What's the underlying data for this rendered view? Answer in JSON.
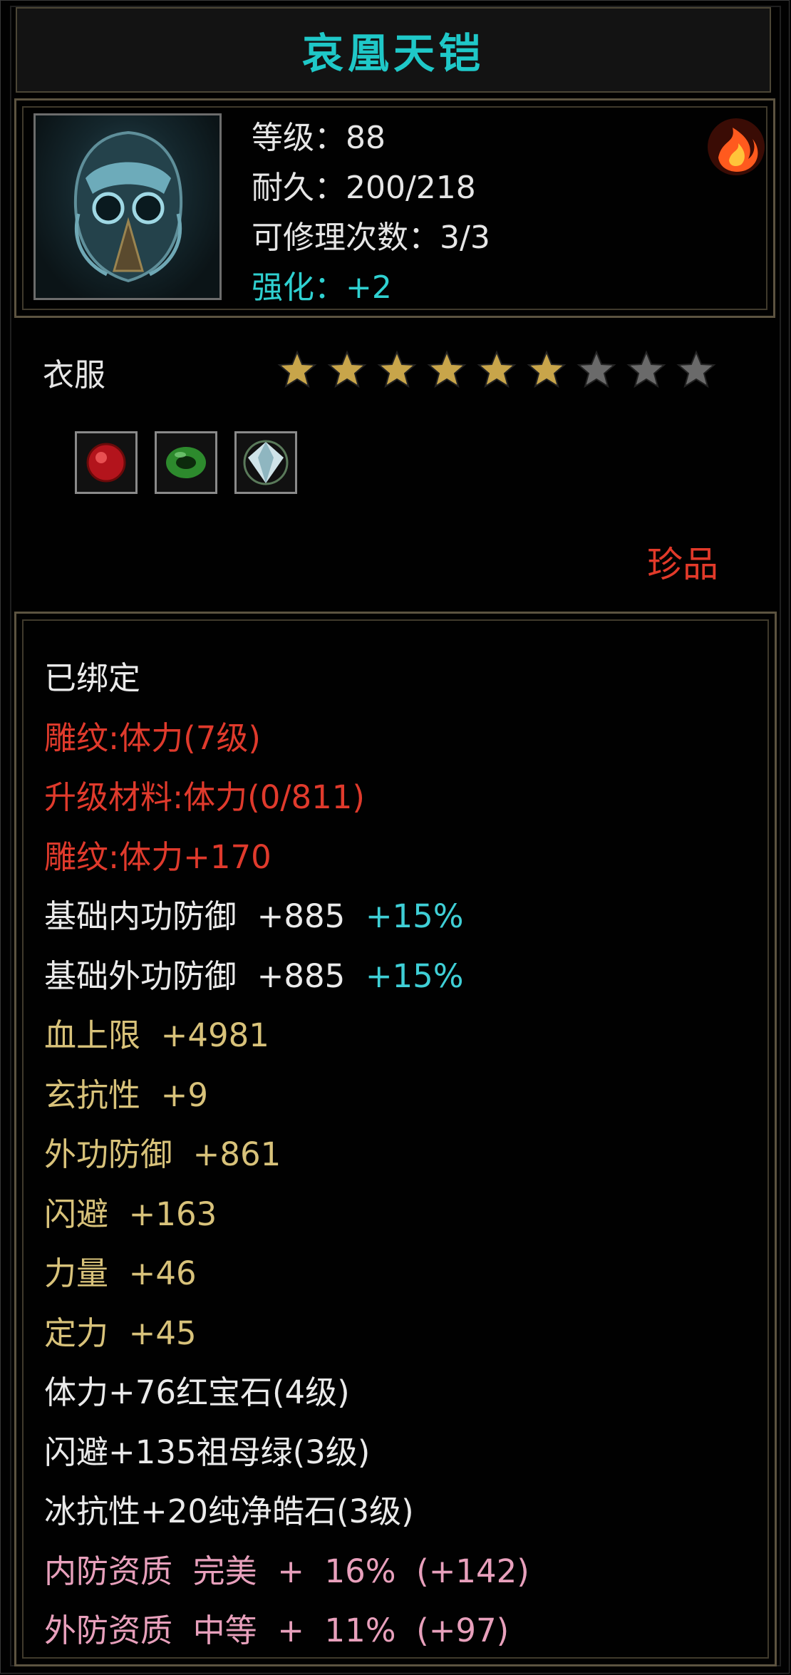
{
  "title": "哀凰天铠",
  "header": {
    "level": "等级：88",
    "durability": "耐久：200/218",
    "repairs": "可修理次数：3/3",
    "enhance": "强化：+2",
    "item_icon": "armor-helmet-icon",
    "element_icon": "fire-element-icon"
  },
  "category": "衣服",
  "stars": {
    "filled": 6,
    "total": 9,
    "filled_color": "#c8a54a",
    "empty_color": "#6a6a6a"
  },
  "gems": [
    "red-gem-icon",
    "green-jade-icon",
    "white-diamond-icon"
  ],
  "rarity": "珍品",
  "details": {
    "bound": "已绑定",
    "engrave1": "雕纹:体力(7级)",
    "upgrade_mat": "升级材料:体力(0/811)",
    "engrave2": "雕纹:体力+170",
    "base_inner_def": "基础内功防御  +885",
    "base_inner_def_pct": "+15%",
    "base_outer_def": "基础外功防御  +885",
    "base_outer_def_pct": "+15%",
    "hp_max": "血上限  +4981",
    "xuan_res": "玄抗性  +9",
    "outer_def": "外功防御  +861",
    "dodge": "闪避  +163",
    "strength": "力量  +46",
    "focus": "定力  +45",
    "gem1": "体力+76红宝石(4级)",
    "gem2": "闪避+135祖母绿(3级)",
    "gem3": "冰抗性+20纯净皓石(3级)",
    "inner_quality": "内防资质  完美  +  16%  (+142)",
    "outer_quality": "外防资质  中等  +  11%  (+97)"
  },
  "colors": {
    "title": "#1fc8c8",
    "red": "#e03a2c",
    "gold": "#d8c27a",
    "cyan": "#3fcfd6",
    "pink": "#e8a0bc"
  }
}
